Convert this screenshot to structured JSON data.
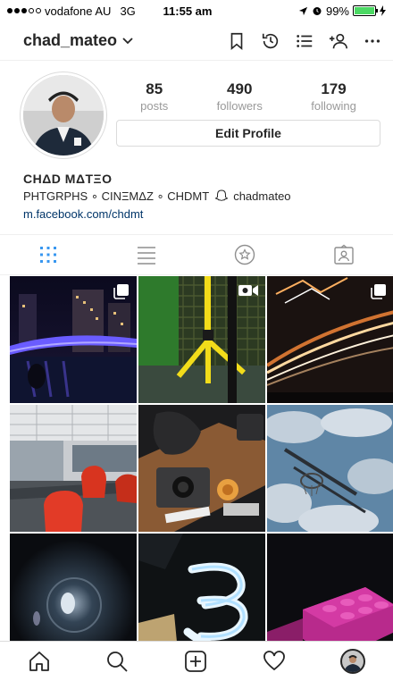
{
  "status_bar": {
    "carrier": "vodafone AU",
    "network": "3G",
    "time": "11:55 am",
    "battery": "99%",
    "battery_level": 0.99
  },
  "nav": {
    "username": "chad_mateo",
    "icons": [
      "bookmark-icon",
      "history-icon",
      "list-icon",
      "add-user-icon",
      "more-icon"
    ]
  },
  "profile": {
    "stats": [
      {
        "value": "85",
        "label": "posts"
      },
      {
        "value": "490",
        "label": "followers"
      },
      {
        "value": "179",
        "label": "following"
      }
    ],
    "edit_label": "Edit Profile"
  },
  "bio": {
    "name": "CHΔD MΔTΞO",
    "line_prefix": "PHTGRPHS ∘ CINΞMΔZ ∘ CHDMT",
    "handle": "chadmateo",
    "link": "m.facebook.com/chdmt"
  },
  "tabs": [
    "grid-icon",
    "list-view-icon",
    "star-icon",
    "tagged-icon"
  ],
  "colors": {
    "accent": "#3897f0",
    "link": "#003569",
    "border": "#dbdbdb",
    "muted": "#999999"
  },
  "grid": [
    {
      "name": "night-city-river",
      "badge": "multiple"
    },
    {
      "name": "yellow-tripod",
      "badge": "video"
    },
    {
      "name": "light-trails",
      "badge": "multiple"
    },
    {
      "name": "office-chairs",
      "badge": ""
    },
    {
      "name": "camera-gear",
      "badge": ""
    },
    {
      "name": "basketball-hoop-sky",
      "badge": ""
    },
    {
      "name": "lens-flare",
      "badge": ""
    },
    {
      "name": "spiral-bulb",
      "badge": ""
    },
    {
      "name": "pink-lego",
      "badge": ""
    }
  ],
  "bottom_nav": [
    "home-icon",
    "search-icon",
    "add-post-icon",
    "activity-icon",
    "profile-avatar"
  ]
}
